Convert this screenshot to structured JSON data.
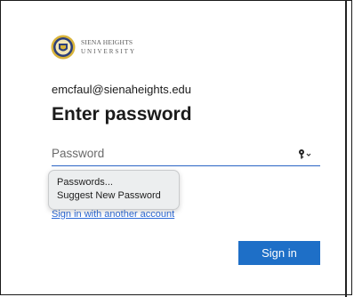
{
  "logo": {
    "line1": "SIENA HEIGHTS",
    "line2": "UNIVERSITY"
  },
  "account": {
    "email": "emcfaul@sienaheights.edu"
  },
  "heading": "Enter password",
  "password_field": {
    "placeholder": "Password",
    "value": ""
  },
  "autofill_menu": {
    "items": [
      "Passwords...",
      "Suggest New Password"
    ]
  },
  "links": {
    "other_account": "Sign in with another account"
  },
  "buttons": {
    "sign_in": "Sign in"
  },
  "colors": {
    "accent": "#1e6fc7",
    "link": "#2d6ad6",
    "underline": "#2a64c5"
  },
  "icons": {
    "seal": "university-seal-icon",
    "key": "key-icon"
  }
}
